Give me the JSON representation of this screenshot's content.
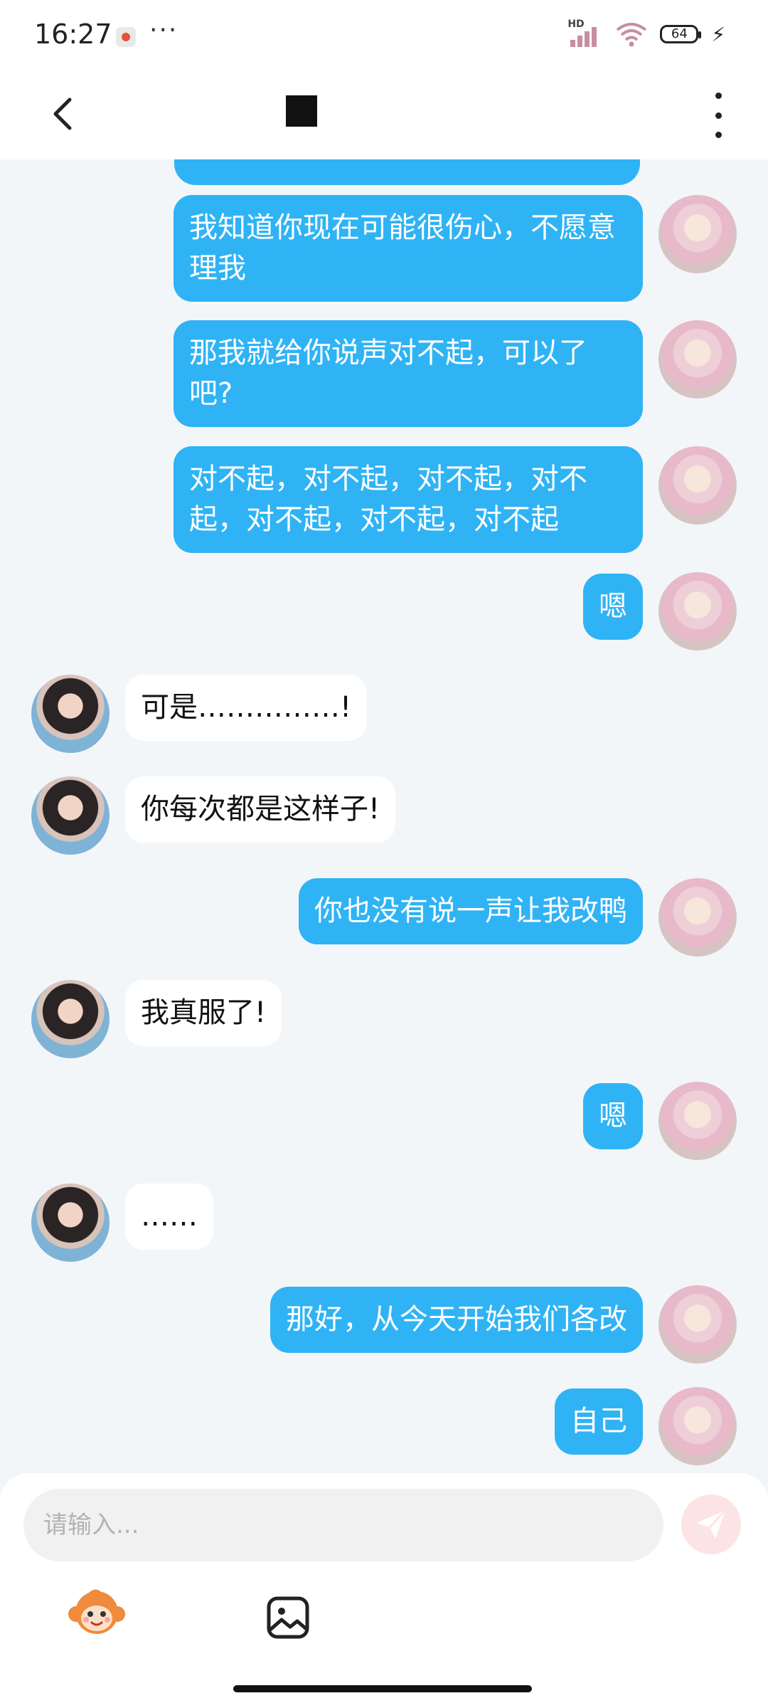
{
  "status_bar": {
    "time": "16:27",
    "dots": "···",
    "network_label": "HD",
    "battery": "64"
  },
  "header": {
    "back_icon": "chevron-left-icon",
    "title_icon": "black-square",
    "more_icon": "vertical-dots-icon"
  },
  "colors": {
    "outgoing_bubble": "#2fb3f5",
    "incoming_bubble": "#ffffff",
    "background": "#f3f6f9",
    "send_button": "#fde4e4",
    "send_icon": "#ffffff"
  },
  "messages": [
    {
      "side": "out",
      "text": "我知道你现在可能很伤心，不愿意理我"
    },
    {
      "side": "out",
      "text": "那我就给你说声对不起，可以了吧?"
    },
    {
      "side": "out",
      "text": "对不起，对不起，对不起，对不起，对不起，对不起，对不起"
    },
    {
      "side": "out",
      "text": "嗯"
    },
    {
      "side": "in",
      "text": "可是……………!"
    },
    {
      "side": "in",
      "text": "你每次都是这样子!"
    },
    {
      "side": "out",
      "text": "你也没有说一声让我改鸭"
    },
    {
      "side": "in",
      "text": "我真服了!"
    },
    {
      "side": "out",
      "text": "嗯"
    },
    {
      "side": "in",
      "text": "……"
    },
    {
      "side": "out",
      "text": "那好，从今天开始我们各改"
    },
    {
      "side": "out",
      "text": "自己"
    }
  ],
  "composer": {
    "placeholder": "请输入...",
    "send_icon": "paper-plane-icon",
    "emoji_icon": "monkey-face-icon",
    "image_icon": "image-icon"
  }
}
